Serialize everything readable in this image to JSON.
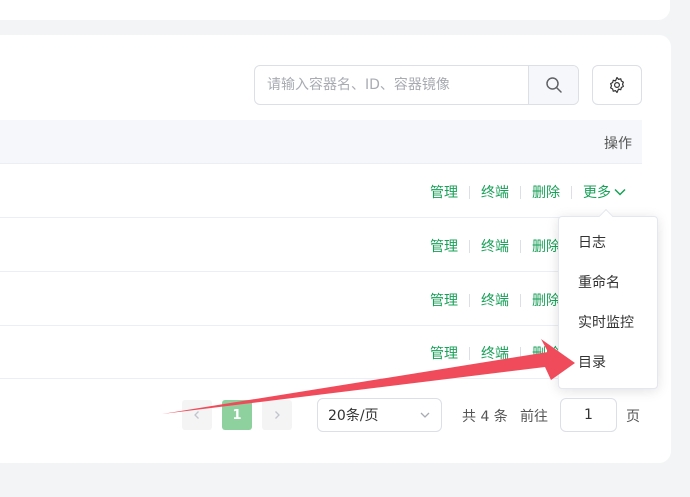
{
  "toolbar": {
    "search_placeholder": "请输入容器名、ID、容器镜像"
  },
  "table": {
    "op_header": "操作",
    "rows": [
      {
        "manage": "管理",
        "terminal": "终端",
        "delete": "删除",
        "more": "更多"
      },
      {
        "manage": "管理",
        "terminal": "终端",
        "delete": "删除"
      },
      {
        "manage": "管理",
        "terminal": "终端",
        "delete": "删除"
      },
      {
        "manage": "管理",
        "terminal": "终端",
        "delete": "删除"
      }
    ]
  },
  "dropdown": {
    "items": [
      "日志",
      "重命名",
      "实时监控",
      "目录"
    ]
  },
  "pagination": {
    "current_page": "1",
    "page_size": "20条/页",
    "total": "共 4 条",
    "goto_label": "前往",
    "goto_value": "1",
    "page_unit": "页"
  },
  "colors": {
    "accent": "#18a058",
    "annotation_arrow": "#f04b5a"
  }
}
